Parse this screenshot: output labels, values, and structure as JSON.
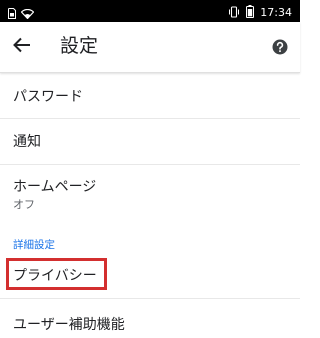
{
  "status_bar": {
    "time": "17:34",
    "icons": [
      "sim-icon",
      "wifi-icon",
      "vibrate-icon",
      "battery-icon"
    ]
  },
  "app_bar": {
    "back_icon": "arrow-back-icon",
    "title": "設定",
    "help_icon": "help-icon"
  },
  "settings": {
    "items": [
      {
        "label": "パスワード"
      },
      {
        "label": "通知"
      },
      {
        "label": "ホームページ",
        "value": "オフ"
      }
    ],
    "advanced_section": {
      "header": "詳細設定",
      "items": [
        {
          "label": "プライバシー",
          "highlighted": true
        },
        {
          "label": "ユーザー補助機能"
        }
      ]
    }
  },
  "colors": {
    "status_bar": "#000000",
    "section_header": "#1a73e8",
    "highlight_border": "#d32f2f",
    "text_primary": "#202124",
    "text_secondary": "#5f6368"
  }
}
